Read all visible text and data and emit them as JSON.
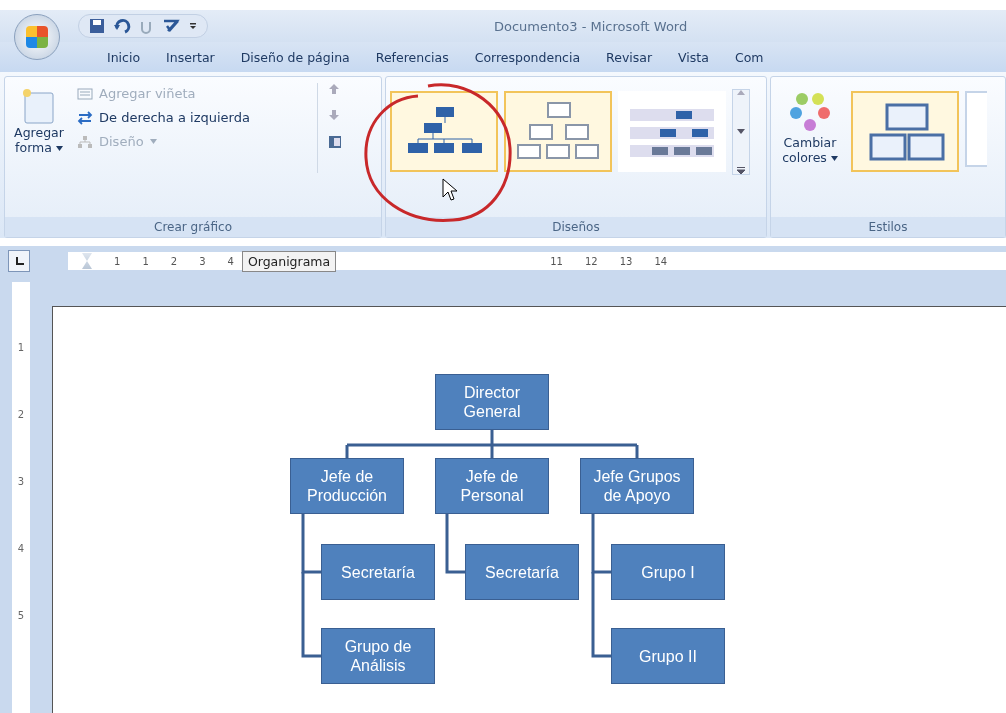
{
  "window": {
    "title": "Documento3 - Microsoft Word"
  },
  "tabs": [
    "Inicio",
    "Insertar",
    "Diseño de página",
    "Referencias",
    "Correspondencia",
    "Revisar",
    "Vista",
    "Com"
  ],
  "ribbon": {
    "groups": [
      {
        "kind": "create",
        "label": "Crear gráfico",
        "add_shape": "Agregar forma",
        "commands": [
          {
            "label": "Agregar viñeta",
            "disabled": true,
            "dropdown": false
          },
          {
            "label": "De derecha a izquierda",
            "disabled": false,
            "dropdown": false
          },
          {
            "label": "Diseño",
            "disabled": true,
            "dropdown": true
          }
        ]
      },
      {
        "kind": "layouts",
        "label": "Diseños",
        "thumbnails": [
          {
            "highlighted": true
          },
          {
            "highlighted": true
          },
          {
            "highlighted": false
          }
        ]
      },
      {
        "kind": "styles",
        "label": "Estilos",
        "change_colors": "Cambiar colores"
      }
    ]
  },
  "ruler": {
    "left_numbers": [
      "1",
      "1",
      "2",
      "3",
      "4"
    ],
    "tooltip": "Organigrama",
    "right_numbers": [
      "11",
      "12",
      "13",
      "14"
    ],
    "vertical_numbers": [
      "1",
      "2",
      "3",
      "4",
      "5"
    ]
  },
  "org_chart": {
    "root": "Director General",
    "children": [
      {
        "label": "Jefe de Producción",
        "children": [
          "Secretaría",
          "Grupo de Análisis"
        ]
      },
      {
        "label": "Jefe de Personal",
        "children": [
          "Secretaría"
        ]
      },
      {
        "label": "Jefe Grupos de Apoyo",
        "children": [
          "Grupo I",
          "Grupo II"
        ]
      }
    ]
  }
}
